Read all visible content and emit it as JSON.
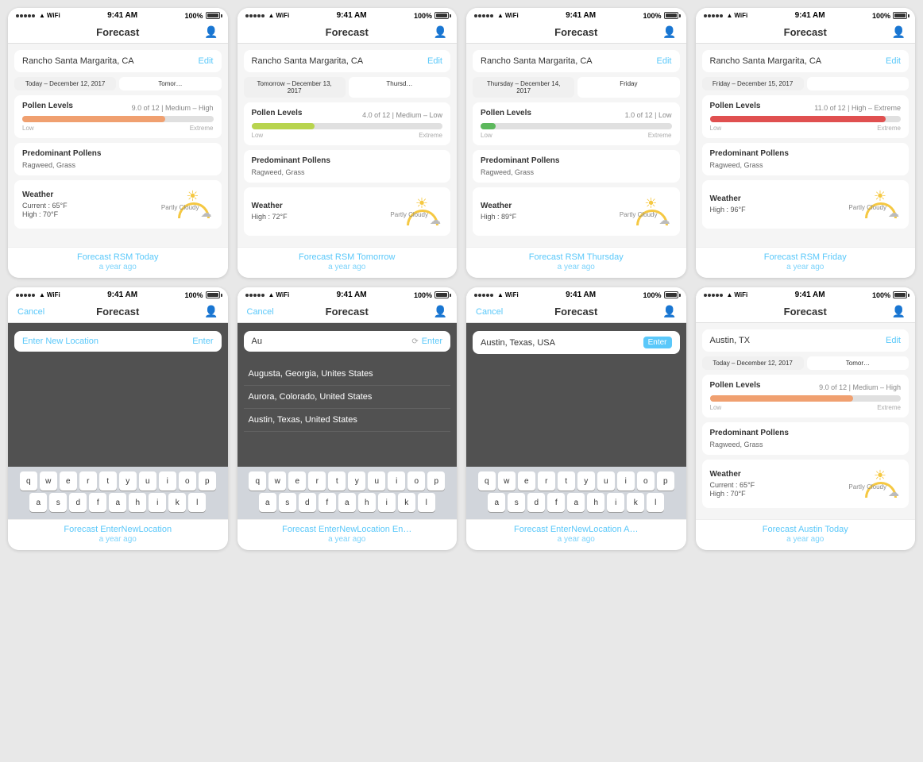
{
  "phones": [
    {
      "id": "forecast-today",
      "status": {
        "signal": "●●●●●",
        "wifi": "WiFi",
        "time": "9:41 AM",
        "battery": "100%"
      },
      "nav": {
        "title": "Forecast",
        "cancel": null
      },
      "location": "Rancho Santa Margarita, CA",
      "dates": [
        "Today – December 12, 2017",
        "Tomor…"
      ],
      "pollen": {
        "label": "Pollen Levels",
        "score": "9.0 of 12 | Medium – High",
        "fillWidth": "75%",
        "fillColor": "#f0a070",
        "barLabels": [
          "Low",
          "Extreme"
        ]
      },
      "predominant": {
        "label": "Predominant Pollens",
        "value": "Ragweed, Grass"
      },
      "weather": {
        "label": "Weather",
        "condition": "Partly Cloudy",
        "current": "Current :  65°F",
        "high": "High :  70°F"
      },
      "caption": {
        "title": "Forecast RSM Today",
        "time": "a year ago"
      },
      "type": "forecast"
    },
    {
      "id": "forecast-tomorrow",
      "status": {
        "signal": "●●●●●",
        "wifi": "WiFi",
        "time": "9:41 AM",
        "battery": "100%"
      },
      "nav": {
        "title": "Forecast",
        "cancel": null
      },
      "location": "Rancho Santa Margarita, CA",
      "dates": [
        "Tomorrow – December 13, 2017",
        "Thursd…"
      ],
      "pollen": {
        "label": "Pollen Levels",
        "score": "4.0 of 12 | Medium – Low",
        "fillWidth": "33%",
        "fillColor": "#b8d44e",
        "barLabels": [
          "Low",
          "Extreme"
        ]
      },
      "predominant": {
        "label": "Predominant Pollens",
        "value": "Ragweed, Grass"
      },
      "weather": {
        "label": "Weather",
        "condition": "Partly Cloudy",
        "current": null,
        "high": "High :  72°F"
      },
      "caption": {
        "title": "Forecast RSM Tomorrow",
        "time": "a year ago"
      },
      "type": "forecast"
    },
    {
      "id": "forecast-thursday",
      "status": {
        "signal": "●●●●●",
        "wifi": "WiFi",
        "time": "9:41 AM",
        "battery": "100%"
      },
      "nav": {
        "title": "Forecast",
        "cancel": null
      },
      "location": "Rancho Santa Margarita, CA",
      "dates": [
        "Thursday – December 14, 2017",
        "Friday"
      ],
      "pollen": {
        "label": "Pollen Levels",
        "score": "1.0 of 12 | Low",
        "fillWidth": "8%",
        "fillColor": "#5cb85c",
        "barLabels": [
          "Low",
          "Extreme"
        ]
      },
      "predominant": {
        "label": "Predominant Pollens",
        "value": "Ragweed, Grass"
      },
      "weather": {
        "label": "Weather",
        "condition": "Partly Cloudy",
        "current": null,
        "high": "High :  89°F"
      },
      "caption": {
        "title": "Forecast RSM Thursday",
        "time": "a year ago"
      },
      "type": "forecast"
    },
    {
      "id": "forecast-friday",
      "status": {
        "signal": "●●●●●",
        "wifi": "WiFi",
        "time": "9:41 AM",
        "battery": "100%"
      },
      "nav": {
        "title": "Forecast",
        "cancel": null
      },
      "location": "Rancho Santa Margarita, CA",
      "dates": [
        "Friday – December 15, 2017",
        ""
      ],
      "pollen": {
        "label": "Pollen Levels",
        "score": "11.0 of 12 | High – Extreme",
        "fillWidth": "92%",
        "fillColor": "#e05050",
        "barLabels": [
          "Low",
          "Extreme"
        ]
      },
      "predominant": {
        "label": "Predominant Pollens",
        "value": "Ragweed, Grass"
      },
      "weather": {
        "label": "Weather",
        "condition": "Partly Cloudy",
        "current": null,
        "high": "High :  96°F"
      },
      "caption": {
        "title": "Forecast RSM Friday",
        "time": "a year ago"
      },
      "type": "forecast"
    },
    {
      "id": "enter-location",
      "status": {
        "signal": "●●●●●",
        "wifi": "WiFi",
        "time": "9:41 AM",
        "battery": "100%"
      },
      "nav": {
        "title": "Forecast",
        "cancel": "Cancel"
      },
      "input": {
        "placeholder": "Enter New Location",
        "value": "",
        "enterLabel": "Enter"
      },
      "suggestions": [],
      "keyboard": true,
      "caption": {
        "title": "Forecast EnterNewLocation",
        "time": "a year ago"
      },
      "type": "entry"
    },
    {
      "id": "enter-location-au",
      "status": {
        "signal": "●●●●●",
        "wifi": "WiFi",
        "time": "9:41 AM",
        "battery": "100%"
      },
      "nav": {
        "title": "Forecast",
        "cancel": "Cancel"
      },
      "input": {
        "placeholder": "",
        "value": "Au",
        "enterLabel": "Enter"
      },
      "suggestions": [
        "Augusta, Georgia, Unites States",
        "Aurora, Colorado, United States",
        "Austin, Texas, United States"
      ],
      "keyboard": true,
      "caption": {
        "title": "Forecast EnterNewLocation En…",
        "time": "a year ago"
      },
      "type": "entry"
    },
    {
      "id": "enter-location-austin",
      "status": {
        "signal": "●●●●●",
        "wifi": "WiFi",
        "time": "9:41 AM",
        "battery": "100%"
      },
      "nav": {
        "title": "Forecast",
        "cancel": "Cancel"
      },
      "input": {
        "placeholder": "",
        "value": "Austin, Texas, USA",
        "enterLabel": "Enter",
        "enterActive": true
      },
      "suggestions": [],
      "keyboard": true,
      "caption": {
        "title": "Forecast EnterNewLocation A…",
        "time": "a year ago"
      },
      "type": "entry"
    },
    {
      "id": "forecast-austin",
      "status": {
        "signal": "●●●●●",
        "wifi": "WiFi",
        "time": "9:41 AM",
        "battery": "100%"
      },
      "nav": {
        "title": "Forecast",
        "cancel": null
      },
      "location": "Austin, TX",
      "dates": [
        "Today – December 12, 2017",
        "Tomor…"
      ],
      "pollen": {
        "label": "Pollen Levels",
        "score": "9.0 of 12 | Medium – High",
        "fillWidth": "75%",
        "fillColor": "#f0a070",
        "barLabels": [
          "Low",
          "Extreme"
        ]
      },
      "predominant": {
        "label": "Predominant Pollens",
        "value": "Ragweed, Grass"
      },
      "weather": {
        "label": "Weather",
        "condition": "Partly Cloudy",
        "current": "Current :  65°F",
        "high": "High :  70°F"
      },
      "caption": {
        "title": "Forecast Austin Today",
        "time": "a year ago"
      },
      "type": "forecast"
    }
  ],
  "keyboard": {
    "row1": [
      "q",
      "w",
      "e",
      "r",
      "t",
      "y",
      "u",
      "i",
      "o",
      "p"
    ],
    "row2": [
      "a",
      "s",
      "d",
      "f",
      "a",
      "h",
      "i",
      "k",
      "l"
    ]
  }
}
